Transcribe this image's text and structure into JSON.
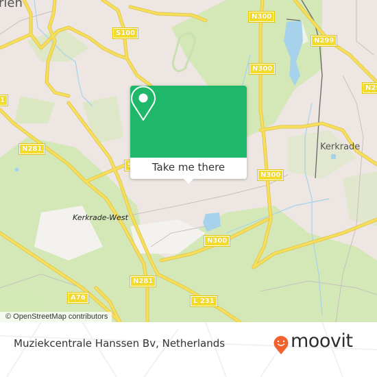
{
  "map": {
    "place_labels": {
      "heerlen_partial": "rlen",
      "kerkrade": "Kerkrade",
      "kerkrade_west": "Kerkrade-West"
    },
    "road_shields": {
      "s100": "S100",
      "n300_top": "N300",
      "n300_mid": "N300",
      "n300_right": "N300",
      "n300_bottom": "N300",
      "n299": "N299",
      "n29_edge": "N29",
      "n281_left": "N281",
      "n281_bottom": "N281",
      "a76": "A76",
      "l231": "L 231",
      "s_partial": "S",
      "edge_1": "1"
    },
    "colors": {
      "land": "#ede6e2",
      "green": "#d3e8b6",
      "water": "#a6d2ec",
      "road": "#f7de5b",
      "brand_green": "#1fb86b",
      "moovit_orange": "#f2622e"
    }
  },
  "popup": {
    "icon": "location-pin-icon",
    "button_label": "Take me there"
  },
  "attribution": "© OpenStreetMap contributors",
  "footer": {
    "place_title": "Muziekcentrale Hanssen Bv, Netherlands",
    "brand_name": "moovit"
  }
}
